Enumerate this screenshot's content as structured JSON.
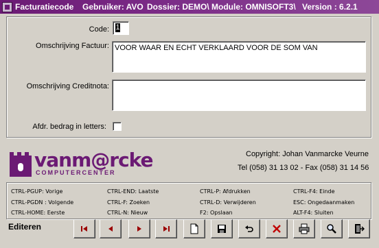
{
  "titlebar": {
    "title": "Facturatiecode",
    "user": "Gebruiker: AVO",
    "dossier": "Dossier: DEMO\\",
    "module": "Module: OMNISOFT3\\",
    "version": "Version : 6.2.1"
  },
  "form": {
    "code_label": "Code:",
    "code_value": "1",
    "factuur_label": "Omschrijving Factuur:",
    "factuur_value": "VOOR WAAR EN ECHT VERKLAARD VOOR DE SOM VAN",
    "creditnota_label": "Omschrijving Creditnota:",
    "creditnota_value": "",
    "letters_label": "Afdr. bedrag in letters:",
    "letters_checked": false
  },
  "logo": {
    "brand": "vanm@rcke",
    "sub": "COMPUTERCENTER"
  },
  "contact": {
    "copyright": "Copyright:  Johan Vanmarcke  Veurne",
    "phone": "Tel (058) 31 13 02  -  Fax (058) 31 14 56"
  },
  "shortcuts": [
    {
      "key": "CTRL-PGUP:",
      "action": "Vorige"
    },
    {
      "key": "CTRL-END:",
      "action": "Laatste"
    },
    {
      "key": "CTRL-P:",
      "action": "Afdrukken"
    },
    {
      "key": "CTRL-F4:",
      "action": "Einde"
    },
    {
      "key": "CTRL-PGDN :",
      "action": "Volgende"
    },
    {
      "key": "CTRL-F:",
      "action": "Zoeken"
    },
    {
      "key": "CTRL-D:",
      "action": "Verwijderen"
    },
    {
      "key": "ESC:",
      "action": "Ongedaanmaken"
    },
    {
      "key": "CTRL-HOME:",
      "action": "Eerste"
    },
    {
      "key": "CTRL-N:",
      "action": "Nieuw"
    },
    {
      "key": "F2:",
      "action": "Opslaan"
    },
    {
      "key": "ALT-F4:",
      "action": "Sluiten"
    }
  ],
  "status": {
    "mode": "Editeren"
  },
  "toolbar": {
    "icons": [
      "first-record-icon",
      "previous-record-icon",
      "next-record-icon",
      "last-record-icon",
      "new-record-icon",
      "save-icon",
      "undo-icon",
      "delete-icon",
      "print-icon",
      "search-icon",
      "exit-icon"
    ]
  }
}
